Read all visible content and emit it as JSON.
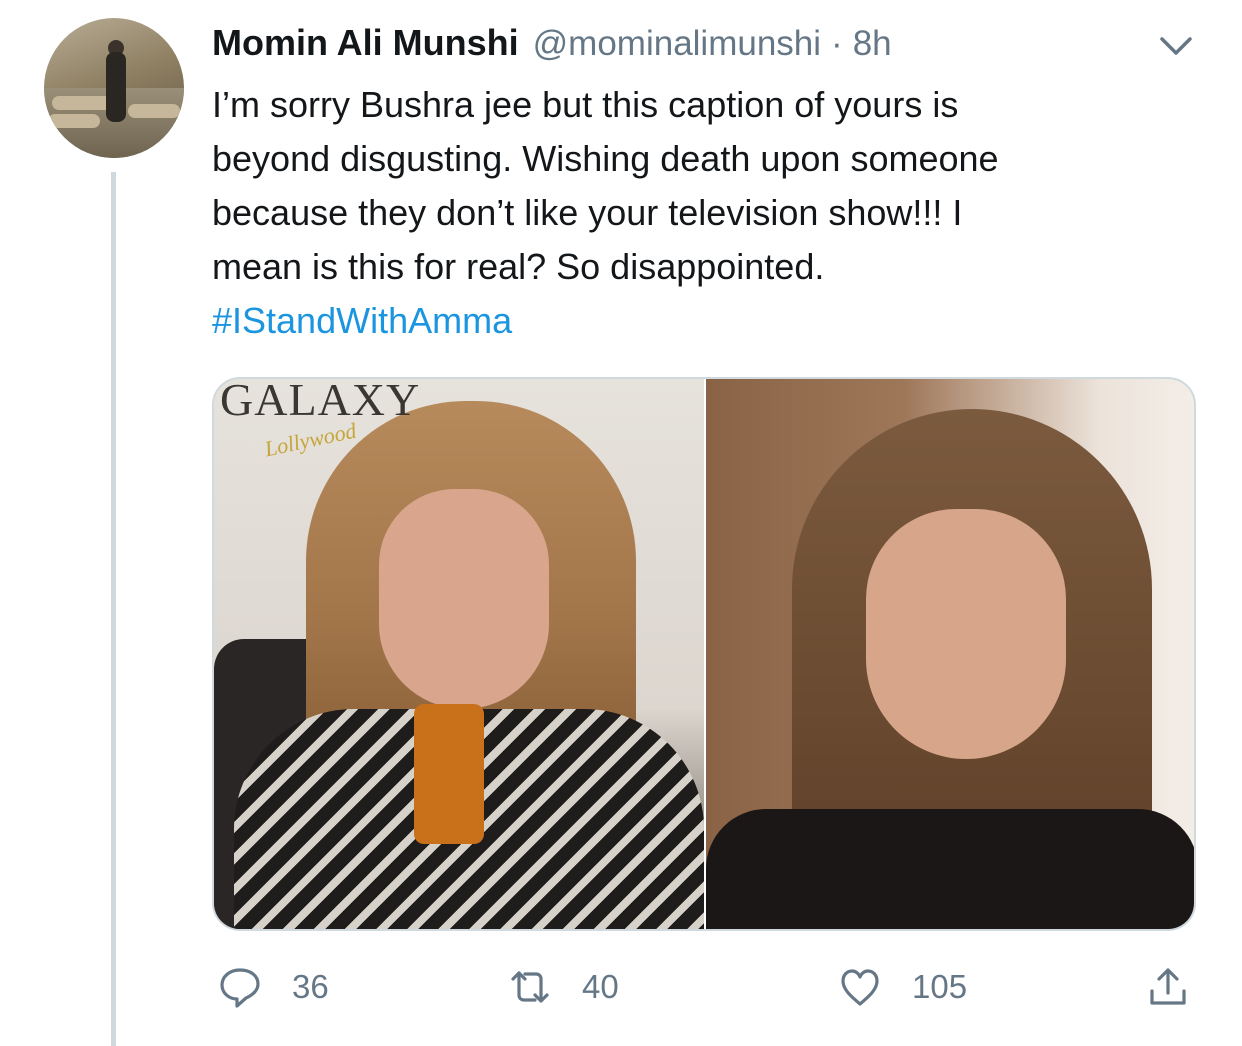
{
  "tweet": {
    "author_name": "Momin Ali Munshi",
    "handle": "@mominalimunshi",
    "separator": "·",
    "time": "8h",
    "text_lines": [
      "I’m sorry Bushra jee but this caption of yours is",
      "beyond disgusting. Wishing death upon someone",
      "because they don’t like your television show!!! I",
      "mean is this for real? So disappointed."
    ],
    "hashtag": "#IStandWithAmma"
  },
  "media": {
    "watermark": "GALAXY",
    "watermark_sub": "Lollywood"
  },
  "actions": {
    "reply_count": "36",
    "retweet_count": "40",
    "like_count": "105"
  },
  "colors": {
    "text": "#14171a",
    "secondary": "#657786",
    "link": "#1b95e0",
    "border": "#cfd9de"
  },
  "icons": [
    "chevron-down-icon",
    "reply-icon",
    "retweet-icon",
    "like-icon",
    "share-icon"
  ]
}
